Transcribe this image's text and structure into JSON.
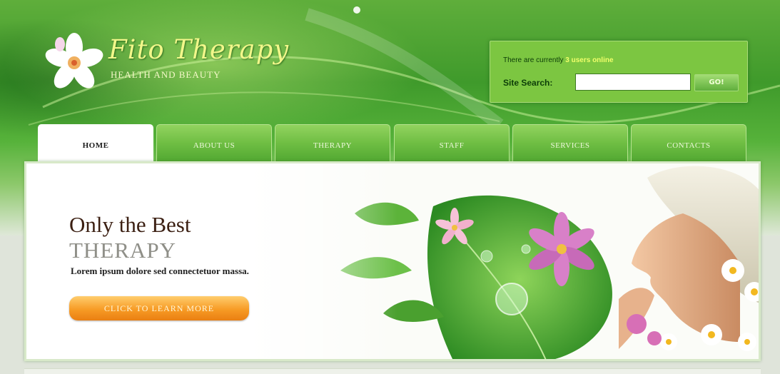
{
  "brand": {
    "title": "Fito Therapy",
    "subtitle": "HEALTH AND BEAUTY"
  },
  "online": {
    "prefix": "There are currently ",
    "count": "3 users online"
  },
  "search": {
    "label": "Site Search:",
    "value": "",
    "button_label": "GO!"
  },
  "nav": {
    "tabs": [
      {
        "label": "HOME",
        "active": true
      },
      {
        "label": "ABOUT US",
        "active": false
      },
      {
        "label": "THERAPY",
        "active": false
      },
      {
        "label": "STAFF",
        "active": false
      },
      {
        "label": "SERVICES",
        "active": false
      },
      {
        "label": "CONTACTS",
        "active": false
      }
    ]
  },
  "banner": {
    "headline": "Only the Best",
    "subhead": "THERAPY",
    "tagline": "Lorem ipsum dolore sed connectetuor massa.",
    "cta_label": "CLICK TO LEARN MORE"
  },
  "colors": {
    "header_green": "#4fa733",
    "tab_green": "#6fbe43",
    "search_box": "#7cc641",
    "cta_orange": "#f79b25",
    "headline_brown": "#3b1f12"
  }
}
